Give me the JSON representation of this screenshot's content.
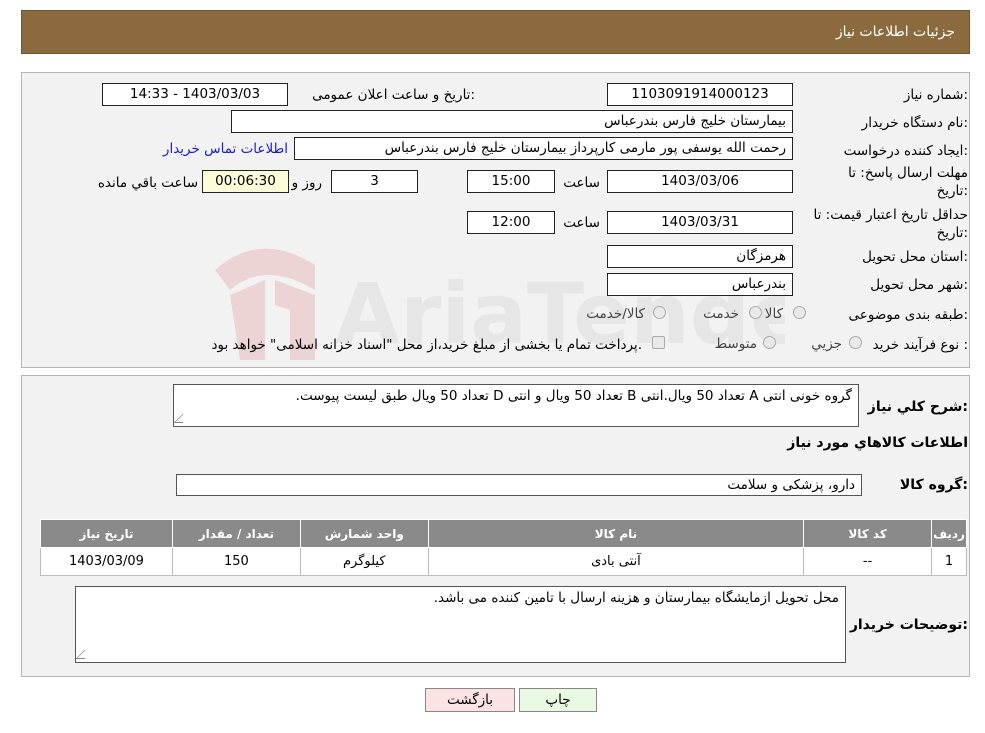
{
  "header": {
    "title": "جزئیات اطلاعات نیاز"
  },
  "form": {
    "need_number_label": "شماره نیاز:",
    "need_number": "1103091914000123",
    "announce_label": "تاریخ و ساعت اعلان عمومی:",
    "announce_value": "1403/03/03 - 14:33",
    "buyer_org_label": "نام دستگاه خریدار:",
    "buyer_org": "بیمارستان خلیج فارس بندرعباس",
    "creator_label": "ایجاد کننده درخواست:",
    "creator": "رحمت الله یوسفی پور مارمی کارپرداز بیمارستان خلیج فارس بندرعباس",
    "contact_link": "اطلاعات تماس خریدار",
    "deadline_label_1": "مهلت ارسال پاسخ: تا",
    "deadline_label_2": "تاریخ:",
    "deadline_date": "1403/03/06",
    "hour_label": "ساعت",
    "deadline_time": "15:00",
    "days": "3",
    "day_and_label": "روز و",
    "remaining_time": "00:06:30",
    "remaining_label": "ساعت باقي مانده",
    "validity_label_1": "حداقل تاریخ اعتبار قیمت: تا",
    "validity_label_2": "تاریخ:",
    "validity_date": "1403/03/31",
    "validity_time": "12:00",
    "province_label": "استان محل تحویل:",
    "province": "هرمزگان",
    "city_label": "شهر محل تحویل:",
    "city": "بندرعباس",
    "category_label": "طبقه بندی موضوعی:",
    "category_options": [
      "کالا",
      "خدمت",
      "کالا/خدمت"
    ],
    "process_label": "نوع فرآیند خرید :",
    "process_options": [
      "جزیي",
      "متوسط"
    ],
    "process_note": "پرداخت تمام یا بخشی از مبلغ خرید،از محل \"اسناد خزانه اسلامی\" خواهد بود."
  },
  "description": {
    "label": "شرح کلي نياز:",
    "text": "گروه خونی انتی A تعداد 50 ویال.انتی B تعداد 50 ویال و انتی D تعداد 50 ویال طبق لیست پیوست."
  },
  "goods": {
    "section_title": "اطلاعات كالاهاي مورد نياز",
    "group_label": "گروه کالا:",
    "group_value": "دارو، پزشکی و سلامت",
    "columns": [
      "رديف",
      "کد کالا",
      "نام کالا",
      "واحد شمارش",
      "تعداد / مقدار",
      "تاریخ نیاز"
    ],
    "rows": [
      [
        "1",
        "--",
        "آنتی بادی",
        "کیلوگرم",
        "150",
        "1403/03/09"
      ]
    ]
  },
  "buyer_notes": {
    "label": "توضیحات خریدار:",
    "text": "محل تحویل ازمایشگاه بیمارستان و هزینه ارسال با تامین کننده می باشد."
  },
  "buttons": {
    "print": "چاپ",
    "back": "بازگشت"
  },
  "watermark": {
    "text": "AriaTender.neT"
  },
  "colors": {
    "header": "#8b6b3e",
    "back_button": "#fbe3e3",
    "print_button": "#eaf9e3",
    "link": "#1a1ad6"
  }
}
